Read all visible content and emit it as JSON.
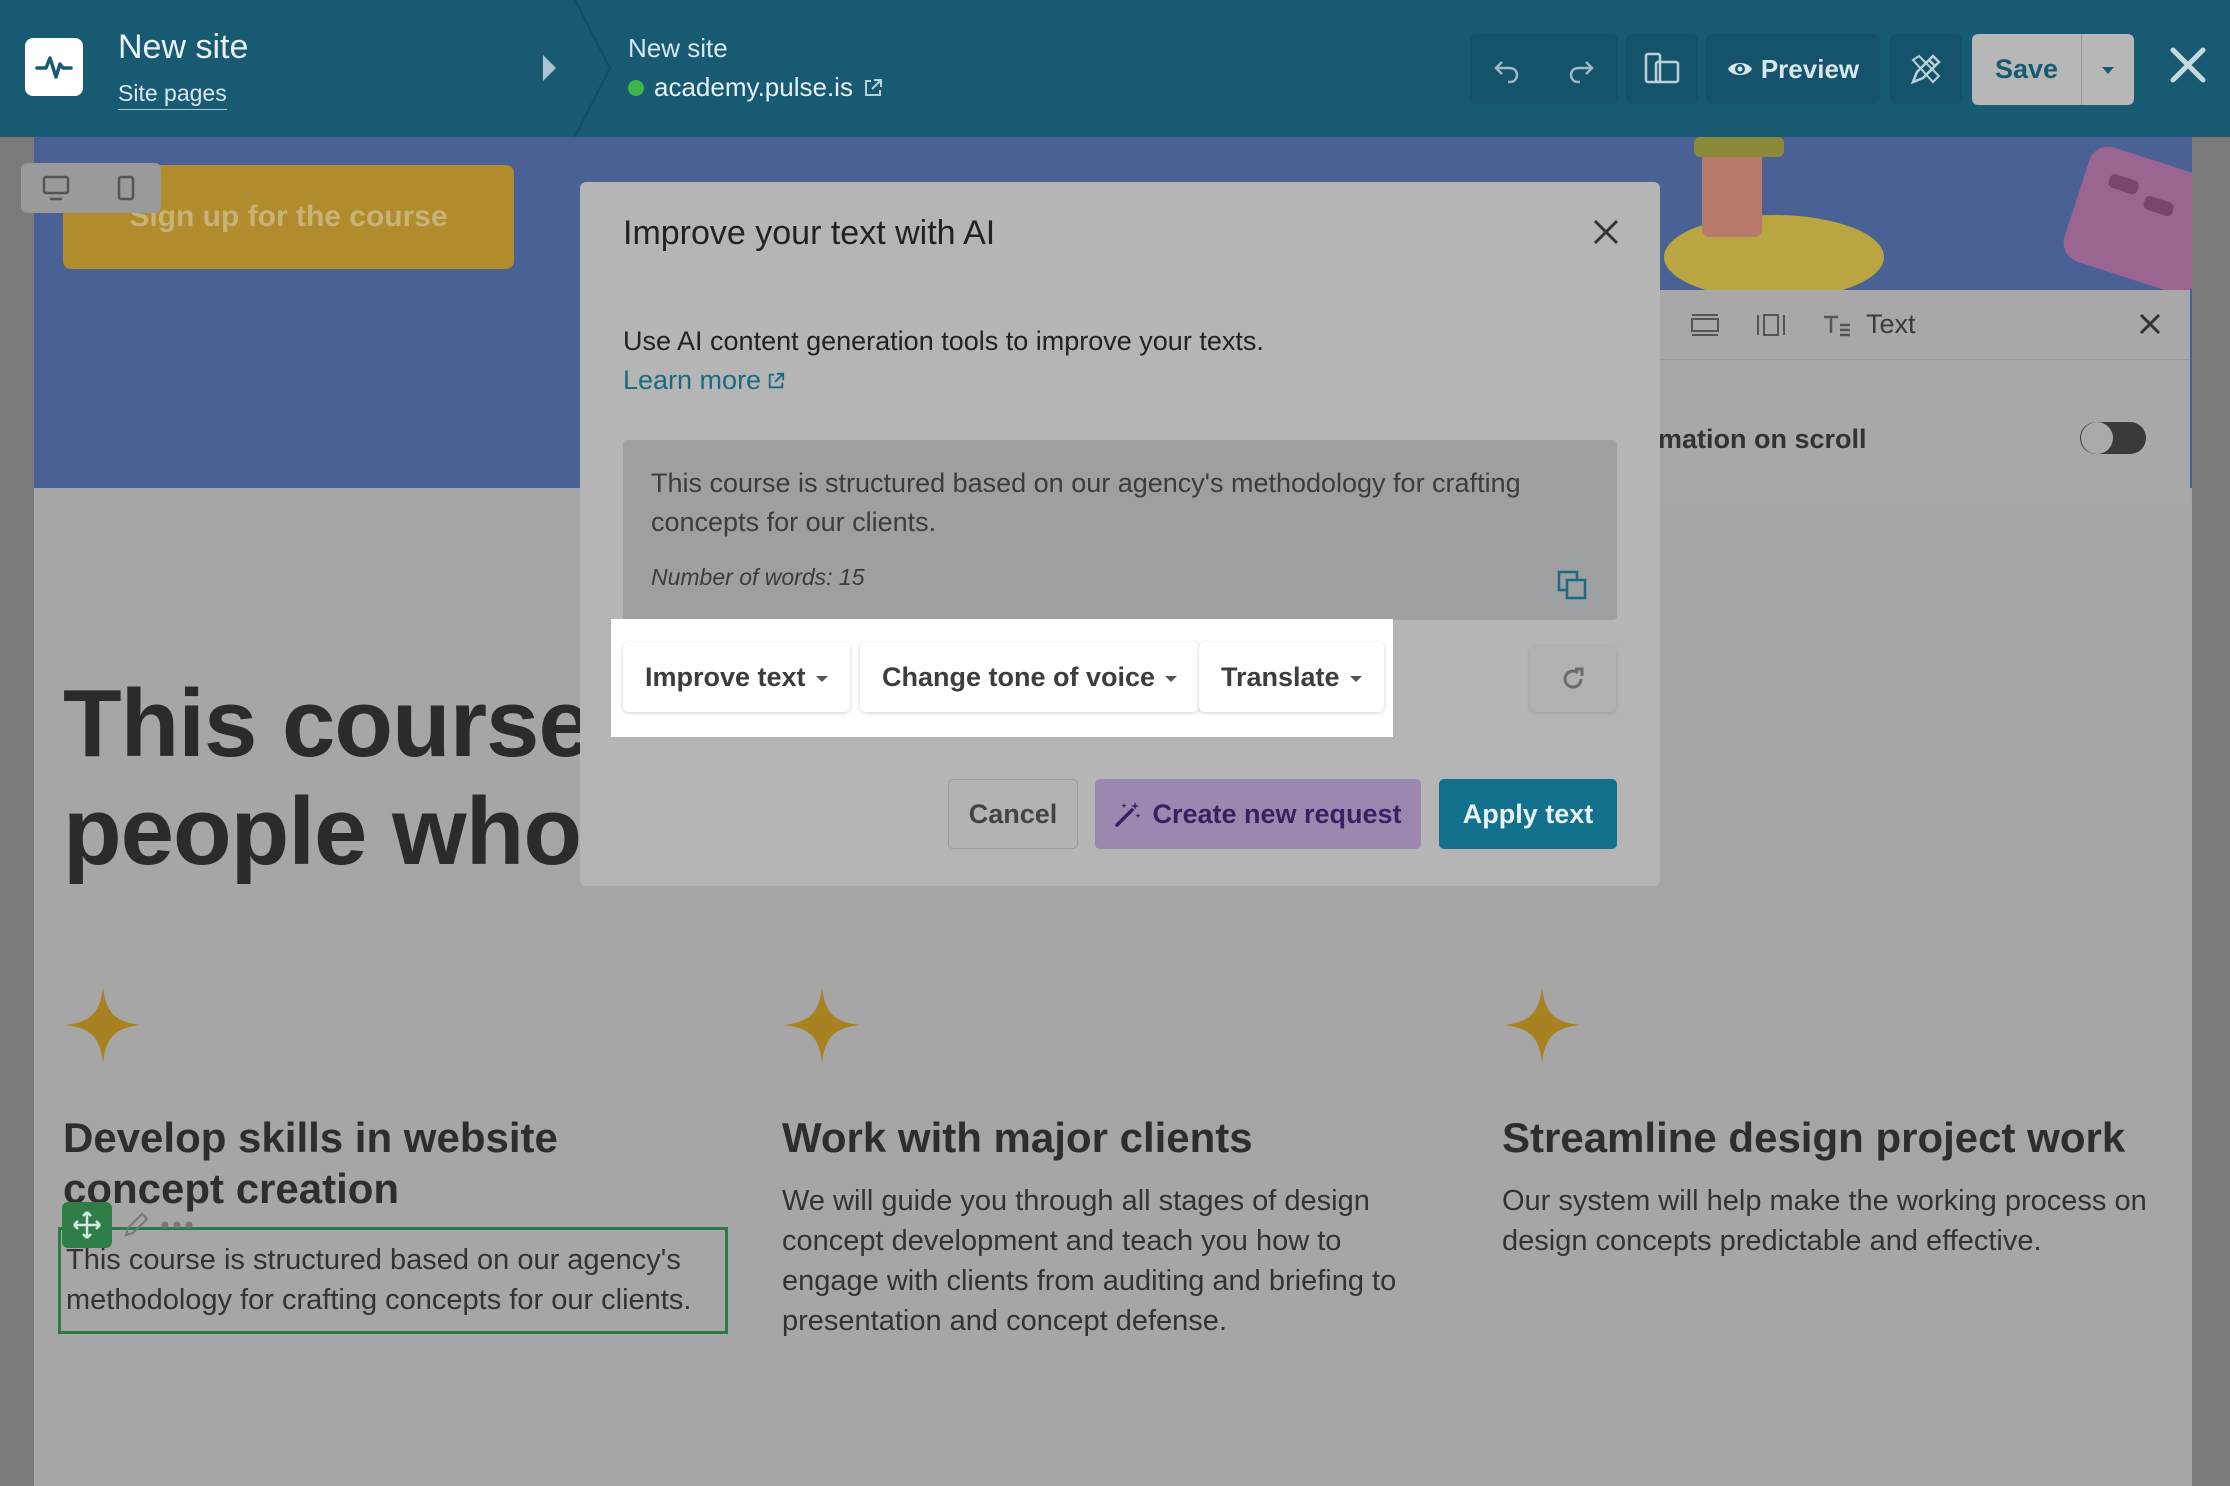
{
  "header": {
    "site_title": "New site",
    "site_pages_link": "Site pages",
    "domain_title": "New site",
    "domain": "academy.pulse.is",
    "preview_label": "Preview",
    "save_label": "Save"
  },
  "viewport": {
    "modes": [
      "desktop",
      "mobile"
    ]
  },
  "page": {
    "hero_button": "Sign up for the course",
    "heading_line1": "This course",
    "heading_line2": "people who",
    "features": [
      {
        "title": "Develop skills in website concept creation",
        "text": "This course is structured based on our agency's methodology for crafting concepts for our clients."
      },
      {
        "title": "Work with major clients",
        "text": "We will guide you through all stages of design concept development and teach you how to engage with clients from auditing and briefing to presentation and concept defense."
      },
      {
        "title": "Streamline design project work",
        "text": "Our system will help make the working process on design concepts predictable and effective."
      }
    ]
  },
  "settings_panel": {
    "tab_text": "Text",
    "animation_label": "mation on scroll",
    "animation_enabled": false
  },
  "modal": {
    "title": "Improve your text with AI",
    "description": "Use AI content generation tools to improve your texts.",
    "learn_more": "Learn more",
    "source_text": "This course is structured based on our agency's methodology for crafting concepts for our clients.",
    "word_count": "Number of words: 15",
    "actions": {
      "improve": "Improve text",
      "tone": "Change tone of voice",
      "translate": "Translate"
    },
    "cancel_label": "Cancel",
    "create_label": "Create new request",
    "apply_label": "Apply text"
  },
  "colors": {
    "header_bg": "#175a72",
    "accent": "#14718d",
    "ai_purple": "#3b1f63",
    "selection_green": "#2b7b45"
  }
}
